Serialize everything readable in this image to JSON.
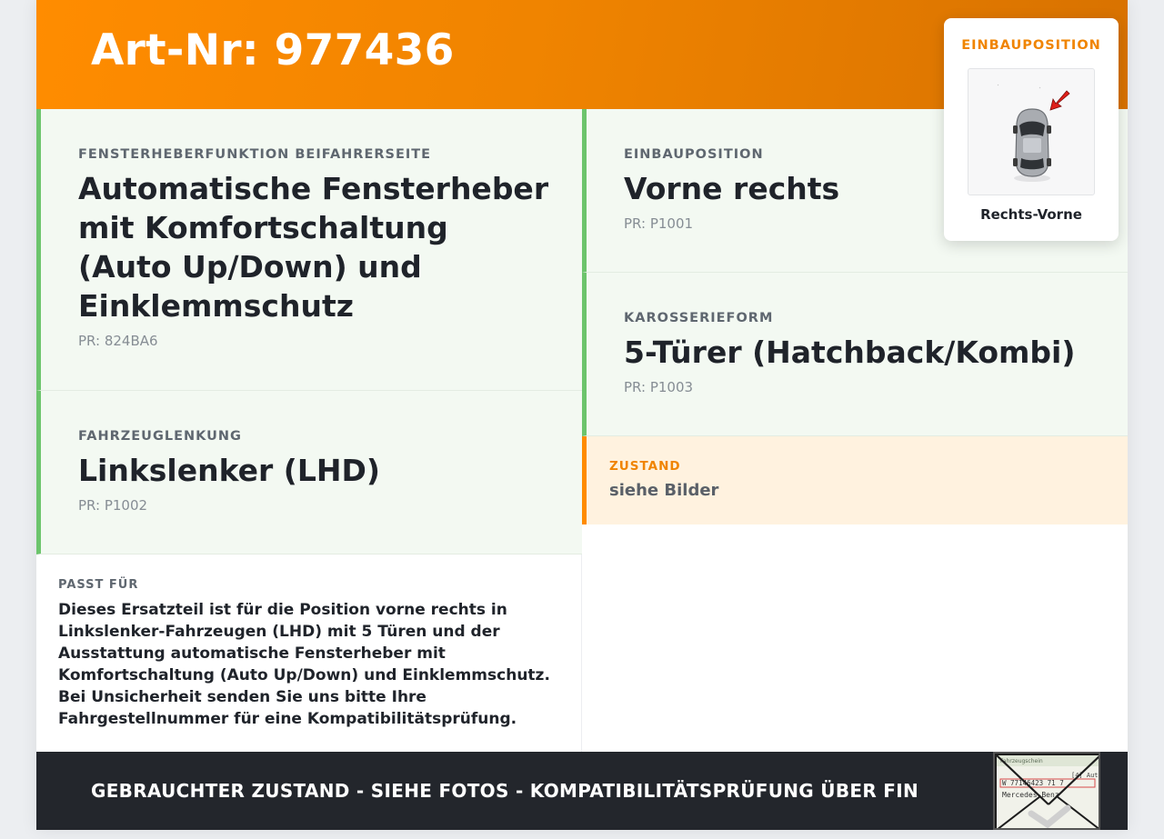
{
  "header": {
    "title": "Art-Nr: 977436"
  },
  "cards": {
    "funktion": {
      "label": "FENSTERHEBERFUNKTION BEIFAHRERSEITE",
      "value": "Automatische Fensterheber mit Komfortschaltung (Auto Up/Down) und Einklemmschutz",
      "pr": "PR: 824BA6"
    },
    "lenkung": {
      "label": "FAHRZEUGLENKUNG",
      "value": "Linkslenker (LHD)",
      "pr": "PR: P1002"
    },
    "position": {
      "label": "EINBAUPOSITION",
      "value": "Vorne rechts",
      "pr": "PR: P1001"
    },
    "karosserie": {
      "label": "KAROSSERIEFORM",
      "value": "5-Türer (Hatchback/Kombi)",
      "pr": "PR: P1003"
    }
  },
  "zustand": {
    "label": "ZUSTAND",
    "value": "siehe Bilder"
  },
  "passt": {
    "label": "PASST FÜR",
    "text": "Dieses Ersatzteil ist für die Position vorne rechts in Linkslenker-Fahrzeugen (LHD) mit 5 Türen und der Ausstattung automatische Fensterheber mit Komfortschaltung (Auto Up/Down) und Einklemmschutz. Bei Unsicherheit senden Sie uns bitte Ihre Fahrgestellnummer für eine Kompatibilitätsprüfung."
  },
  "footer": {
    "text": "GEBRAUCHTER ZUSTAND - SIEHE FOTOS - KOMPATIBILITÄTSPRÜFUNG ÜBER FIN"
  },
  "popup": {
    "title": "EINBAUPOSITION",
    "caption": "Rechts-Vorne",
    "icon": "car-top-view-icon"
  },
  "doc_thumb": {
    "icon": "vehicle-registration-document-icon",
    "lines": [
      "Fahrzeugschein",
      "[4]  Aut",
      "W  77146423  71  7",
      "Mercedes-Benz"
    ]
  },
  "colors": {
    "accent": "#ff8c00",
    "accent_dark": "#d87200",
    "card_bg": "#f3f9f2",
    "card_border": "#6cc46c",
    "zustand_bg": "#fff2df",
    "footer_bg": "#23262c",
    "marker": "#e0201a"
  }
}
